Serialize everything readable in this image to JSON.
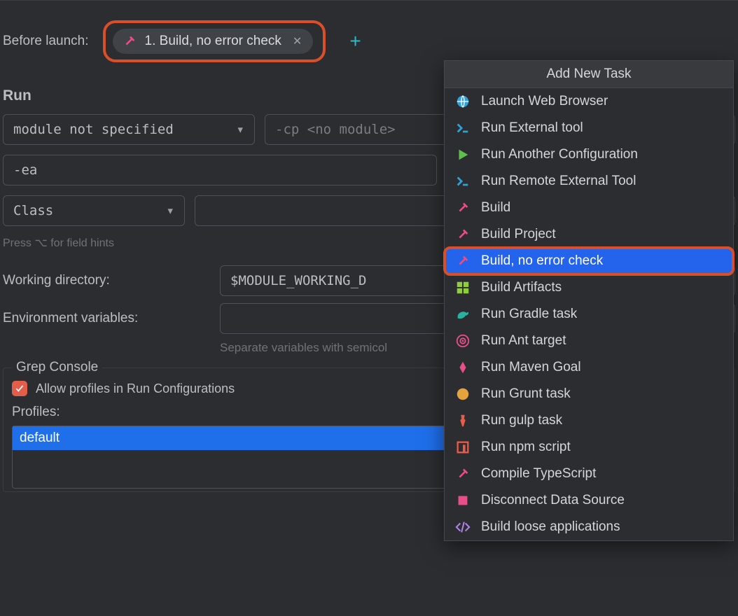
{
  "before_launch": {
    "label": "Before launch:",
    "tag_text": "1. Build, no error check"
  },
  "run": {
    "title": "Run",
    "module_dd": "module not specified",
    "cp_text": "-cp <no module>",
    "vm_options": "-ea",
    "class_dd": "Class",
    "hint": "Press ⌥ for field hints",
    "working_dir_label": "Working directory:",
    "working_dir_value": "$MODULE_WORKING_D",
    "env_label": "Environment variables:",
    "env_help": "Separate variables with semicol"
  },
  "grep": {
    "title": "Grep Console",
    "allow_label": "Allow profiles in Run Configurations",
    "profiles_label": "Profiles:",
    "profile_item": "default"
  },
  "popup": {
    "title": "Add New Task",
    "items": [
      {
        "label": "Launch Web Browser",
        "icon": "globe"
      },
      {
        "label": "Run External tool",
        "icon": "terminal"
      },
      {
        "label": "Run Another Configuration",
        "icon": "play"
      },
      {
        "label": "Run Remote External Tool",
        "icon": "terminal"
      },
      {
        "label": "Build",
        "icon": "hammer"
      },
      {
        "label": "Build Project",
        "icon": "hammer"
      },
      {
        "label": "Build, no error check",
        "icon": "hammer",
        "selected": true
      },
      {
        "label": "Build Artifacts",
        "icon": "grid"
      },
      {
        "label": "Run Gradle task",
        "icon": "gradle"
      },
      {
        "label": "Run Ant target",
        "icon": "target"
      },
      {
        "label": "Run Maven Goal",
        "icon": "maven"
      },
      {
        "label": "Run Grunt task",
        "icon": "grunt"
      },
      {
        "label": "Run gulp task",
        "icon": "gulp"
      },
      {
        "label": "Run npm script",
        "icon": "npm"
      },
      {
        "label": "Compile TypeScript",
        "icon": "hammer"
      },
      {
        "label": "Disconnect Data Source",
        "icon": "square"
      },
      {
        "label": "Build loose applications",
        "icon": "code"
      }
    ]
  }
}
